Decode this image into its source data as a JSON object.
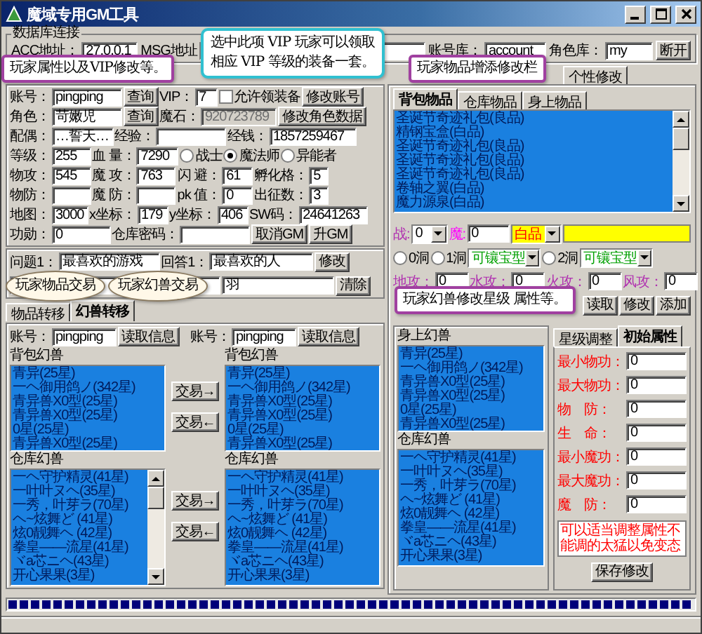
{
  "window": {
    "title": "魔域专用GM工具"
  },
  "db": {
    "title": "数据库连接",
    "items": [
      {
        "kind": "label",
        "text": "ACC地址："
      },
      {
        "kind": "field",
        "value": "27.0.0.1"
      },
      {
        "kind": "label",
        "text": "MSG地址"
      },
      {
        "kind": "field"
      },
      {
        "kind": "label",
        "text": "账号库："
      },
      {
        "kind": "field",
        "value": "account"
      },
      {
        "kind": "label",
        "text": "角色库："
      },
      {
        "kind": "field",
        "value": "my"
      },
      {
        "kind": "button",
        "text": "断开"
      }
    ]
  },
  "main_tabs": [
    {
      "label": "个性修改",
      "selected": false
    }
  ],
  "player": {
    "rows": [
      [
        {
          "kind": "label",
          "text": "账号："
        },
        {
          "kind": "field",
          "value": "pingping"
        },
        {
          "kind": "button",
          "text": "查询"
        },
        {
          "kind": "label",
          "text": "VIP："
        },
        {
          "kind": "field",
          "value": "7"
        },
        {
          "kind": "checkbox",
          "text": "允许领装备",
          "checked": false
        },
        {
          "kind": "button",
          "text": "修改账号"
        }
      ],
      [
        {
          "kind": "label",
          "text": "角色："
        },
        {
          "kind": "field",
          "value": "苛嫩児"
        },
        {
          "kind": "button",
          "text": "查询"
        },
        {
          "kind": "label",
          "text": "魔石："
        },
        {
          "kind": "field",
          "value": "920723789",
          "disabled": true
        },
        {
          "kind": "button",
          "text": "修改角色数据"
        }
      ],
      [
        {
          "kind": "label",
          "text": "配偶："
        },
        {
          "kind": "field",
          "value": "…誓天…"
        },
        {
          "kind": "label",
          "text": "经验："
        },
        {
          "kind": "field"
        },
        {
          "kind": "label",
          "text": "经钱："
        },
        {
          "kind": "field",
          "value": "1857259467"
        }
      ],
      [
        {
          "kind": "label",
          "text": "等级："
        },
        {
          "kind": "field",
          "value": "255"
        },
        {
          "kind": "label",
          "text": "血 量："
        },
        {
          "kind": "field",
          "value": "7290"
        },
        {
          "kind": "radio",
          "text": "战士",
          "selected": false
        },
        {
          "kind": "radio",
          "text": "魔法师",
          "selected": true
        },
        {
          "kind": "radio",
          "text": "异能者",
          "selected": false
        }
      ],
      [
        {
          "kind": "label",
          "text": "物攻："
        },
        {
          "kind": "field",
          "value": "545"
        },
        {
          "kind": "label",
          "text": "魔 攻："
        },
        {
          "kind": "field",
          "value": "763"
        },
        {
          "kind": "label",
          "text": "闪 避："
        },
        {
          "kind": "field",
          "value": "61"
        },
        {
          "kind": "label",
          "text": "孵化格："
        },
        {
          "kind": "field",
          "value": "5"
        }
      ],
      [
        {
          "kind": "label",
          "text": "物防："
        },
        {
          "kind": "field"
        },
        {
          "kind": "label",
          "text": "魔 防："
        },
        {
          "kind": "field"
        },
        {
          "kind": "label",
          "text": "pk 值："
        },
        {
          "kind": "field",
          "value": "0"
        },
        {
          "kind": "label",
          "text": "出征数："
        },
        {
          "kind": "field",
          "value": "3"
        }
      ],
      [
        {
          "kind": "label",
          "text": "地图："
        },
        {
          "kind": "field",
          "value": "3000"
        },
        {
          "kind": "label",
          "text": "x坐标："
        },
        {
          "kind": "field",
          "value": "179"
        },
        {
          "kind": "label",
          "text": "y坐标："
        },
        {
          "kind": "field",
          "value": "406"
        },
        {
          "kind": "label",
          "text": "SW码："
        },
        {
          "kind": "field",
          "value": "24641263"
        }
      ],
      [
        {
          "kind": "label",
          "text": "功勋："
        },
        {
          "kind": "field",
          "value": "0"
        },
        {
          "kind": "label",
          "text": "仓库密码："
        },
        {
          "kind": "field"
        },
        {
          "kind": "button",
          "text": "取消GM"
        },
        {
          "kind": "button",
          "text": "升GM"
        }
      ]
    ]
  },
  "security": {
    "rows": [
      {
        "controls": [
          {
            "kind": "label",
            "text": "问题1："
          },
          {
            "kind": "field",
            "value": "最喜欢的游戏"
          },
          {
            "kind": "label",
            "text": "回答1："
          },
          {
            "kind": "field",
            "value": "最喜欢的人"
          },
          {
            "kind": "button",
            "text": "修改"
          }
        ]
      },
      {
        "controls": [
          {
            "kind": "field"
          },
          {
            "kind": "field",
            "value": "羽"
          },
          {
            "kind": "button",
            "text": "清除"
          }
        ]
      }
    ]
  },
  "transfer": {
    "tabs": [
      {
        "label": "物品转移",
        "selected": false
      },
      {
        "label": "幻兽转移",
        "selected": true
      }
    ],
    "sides": [
      {
        "account_label": "账号：",
        "account": "pingping",
        "read_button": "读取信息",
        "bag_title": "背包幻兽",
        "bag": [
          "青异(25星)",
          "一ヘ御用鸽ノ(342星)",
          "青异兽X0型(25星)",
          "青异兽X0型(25星)",
          "0星(25星)",
          "青异兽X0型(25星)"
        ],
        "store_title": "仓库幻兽",
        "store": [
          "一ヘ守护精灵(41星)",
          "一叶叶ヌヘ(35星)",
          "一秀，叶芽ラ(70星)",
          "ヘ~炫舞ど (41星)",
          "炫0靓舞ヘ (42星)",
          "拳皇——流星(41星)",
          "ヾa芯ニヘ(43星)",
          "开心果果(3星)"
        ]
      },
      {
        "account_label": "账号：",
        "account": "pingping",
        "read_button": "读取信息",
        "bag_title": "背包幻兽",
        "bag": [
          "青异(25星)",
          "一ヘ御用鸽ノ(342星)",
          "青异兽X0型(25星)",
          "青异兽X0型(25星)",
          "0星(25星)",
          "青异兽X0型(25星)"
        ],
        "store_title": "仓库幻兽",
        "store": [
          "一ヘ守护精灵(41星)",
          "一叶叶ヌヘ(35星)",
          "一秀，叶芽ラ(70星)",
          "ヘ~炫舞ど (41星)",
          "炫0靓舞ヘ (42星)",
          "拳皇——流星(41星)",
          "ヾa芯ニヘ(43星)",
          "开心果果(3星)"
        ]
      }
    ],
    "bag_buttons": [
      "交易→",
      "交易←"
    ],
    "store_buttons": [
      "交易→",
      "交易←"
    ]
  },
  "items": {
    "tabs": [
      {
        "label": "背包物品",
        "selected": true
      },
      {
        "label": "仓库物品",
        "selected": false
      },
      {
        "label": "身上物品",
        "selected": false
      }
    ],
    "list": [
      "圣诞节奇迹礼包(良品)",
      "精钢宝盒(白品)",
      "圣诞节奇迹礼包(良品)",
      "圣诞节奇迹礼包(良品)",
      "圣诞节奇迹礼包(良品)",
      "卷轴之翼(白品)",
      "魔力源泉(白品)"
    ],
    "lines": [
      {
        "controls": [
          {
            "kind": "label",
            "text": "战:",
            "color": "#b030b0"
          },
          {
            "kind": "dropdown",
            "value": "0"
          },
          {
            "kind": "label",
            "text": "魔:",
            "color": "#ff00ff"
          },
          {
            "kind": "field",
            "value": "0"
          },
          {
            "kind": "grade",
            "value": "白品"
          },
          {
            "kind": "swatch",
            "color": "#ffff00"
          }
        ]
      },
      {
        "controls": [
          {
            "kind": "radio",
            "text": "0洞",
            "selected": false
          },
          {
            "kind": "radio",
            "text": "1洞",
            "selected": false
          },
          {
            "kind": "dropdown",
            "value": "可镶宝型",
            "color": "#00a000"
          },
          {
            "kind": "radio",
            "text": "2洞",
            "selected": false
          },
          {
            "kind": "dropdown",
            "value": "可镶宝型",
            "color": "#00a000"
          }
        ]
      },
      {
        "controls": [
          {
            "kind": "label",
            "text": "地攻：",
            "color": "#b030b0"
          },
          {
            "kind": "field",
            "value": "0"
          },
          {
            "kind": "label",
            "text": "水攻：",
            "color": "#b030b0"
          },
          {
            "kind": "field",
            "value": "0"
          },
          {
            "kind": "label",
            "text": "火攻：",
            "color": "#b030b0"
          },
          {
            "kind": "field",
            "value": "0"
          },
          {
            "kind": "label",
            "text": "风攻：",
            "color": "#b030b0"
          },
          {
            "kind": "field",
            "value": "0"
          }
        ]
      }
    ],
    "buttons": [
      "读取",
      "修改",
      "添加"
    ]
  },
  "pets": {
    "body_title": "身上幻兽",
    "body": [
      "青异(25星)",
      "一ヘ御用鸽ノ(342星)",
      "青异兽X0型(25星)",
      "青异兽X0型(25星)",
      "0星(25星)",
      "青异兽X0型(25星)"
    ],
    "store_title": "仓库幻兽",
    "store": [
      "一ヘ守护精灵(41星)",
      "一叶叶ヌヘ(35星)",
      "一秀，叶芽ラ(70星)",
      "ヘ~炫舞ど (41星)",
      "炫0靓舞ヘ (42星)",
      "拳皇——流星(41星)",
      "ヾa芯ニヘ(43星)",
      "开心果果(3星)"
    ]
  },
  "stats": {
    "tabs": [
      {
        "label": "星级调整",
        "selected": false
      },
      {
        "label": "初始属性",
        "selected": true
      }
    ],
    "fields": [
      {
        "label": "最小物功：",
        "value": "0"
      },
      {
        "label": "最大物功：",
        "value": "0"
      },
      {
        "label": "物　防：",
        "value": "0"
      },
      {
        "label": "生　命：",
        "value": "0"
      },
      {
        "label": "最小魔功：",
        "value": "0"
      },
      {
        "label": "最大魔功：",
        "value": "0"
      },
      {
        "label": "魔　防：",
        "value": "0"
      }
    ],
    "note": "可以适当调整属性不能调的太猛以免变态",
    "save_button": "保存修改"
  },
  "progress": {
    "level": 1
  },
  "callouts": [
    {
      "kind": "bubble",
      "lines": [
        "选中此项 VIP 玩家可以领取",
        "相应 VIP 等级的装备一套。"
      ]
    },
    {
      "kind": "box",
      "lines": [
        "玩家属性以及VIP修改等。"
      ]
    },
    {
      "kind": "box",
      "lines": [
        "玩家物品增添修改栏"
      ]
    },
    {
      "kind": "ellipse",
      "lines": [
        "玩家物品交易"
      ]
    },
    {
      "kind": "ellipse",
      "lines": [
        "玩家幻兽交易"
      ]
    },
    {
      "kind": "box",
      "lines": [
        "玩家幻兽修改星级 属性等。"
      ]
    }
  ]
}
